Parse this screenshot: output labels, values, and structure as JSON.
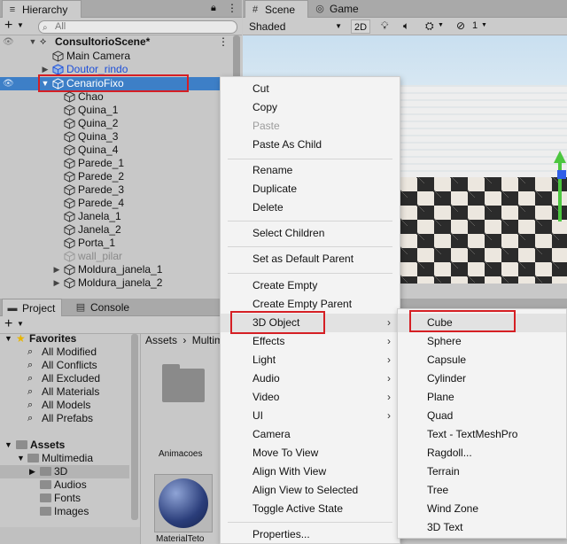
{
  "hierarchy": {
    "tab_label": "Hierarchy",
    "search_placeholder": "All",
    "scene_name": "ConsultorioScene*",
    "items": [
      {
        "label": "Main Camera"
      },
      {
        "label": "Doutor_rindo"
      },
      {
        "label": "CenarioFixo"
      },
      {
        "label": "Chao"
      },
      {
        "label": "Quina_1"
      },
      {
        "label": "Quina_2"
      },
      {
        "label": "Quina_3"
      },
      {
        "label": "Quina_4"
      },
      {
        "label": "Parede_1"
      },
      {
        "label": "Parede_2"
      },
      {
        "label": "Parede_3"
      },
      {
        "label": "Parede_4"
      },
      {
        "label": "Janela_1"
      },
      {
        "label": "Janela_2"
      },
      {
        "label": "Porta_1"
      },
      {
        "label": "wall_pilar"
      },
      {
        "label": "Moldura_janela_1"
      },
      {
        "label": "Moldura_janela_2"
      }
    ]
  },
  "scene": {
    "tab_scene": "Scene",
    "tab_game": "Game",
    "shading_mode": "Shaded",
    "mode_2d": "2D",
    "gizmo_count": "1"
  },
  "project": {
    "tab_project": "Project",
    "tab_console": "Console",
    "favorites_label": "Favorites",
    "favorites": [
      "All Modified",
      "All Conflicts",
      "All Excluded",
      "All Materials",
      "All Models",
      "All Prefabs"
    ],
    "assets_label": "Assets",
    "assets_tree": [
      "Multimedia",
      "3D",
      "Audios",
      "Fonts",
      "Images"
    ],
    "breadcrumb": [
      "Assets",
      "Multim"
    ],
    "grid_items": [
      {
        "label": "Animacoes"
      },
      {
        "label": "MaterialTeto"
      }
    ]
  },
  "context_menu": {
    "items": [
      "Cut",
      "Copy",
      "Paste",
      "Paste As Child",
      "Rename",
      "Duplicate",
      "Delete",
      "Select Children",
      "Set as Default Parent",
      "Create Empty",
      "Create Empty Parent",
      "3D Object",
      "Effects",
      "Light",
      "Audio",
      "Video",
      "UI",
      "Camera",
      "Move To View",
      "Align With View",
      "Align View to Selected",
      "Toggle Active State",
      "Properties..."
    ]
  },
  "submenu_3d": {
    "items": [
      "Cube",
      "Sphere",
      "Capsule",
      "Cylinder",
      "Plane",
      "Quad",
      "Text - TextMeshPro",
      "Ragdoll...",
      "Terrain",
      "Tree",
      "Wind Zone",
      "3D Text"
    ]
  },
  "colors": {
    "selection": "#3d7fc7",
    "highlight_box": "#d51f24",
    "prefab_text": "#1e4fd8"
  }
}
